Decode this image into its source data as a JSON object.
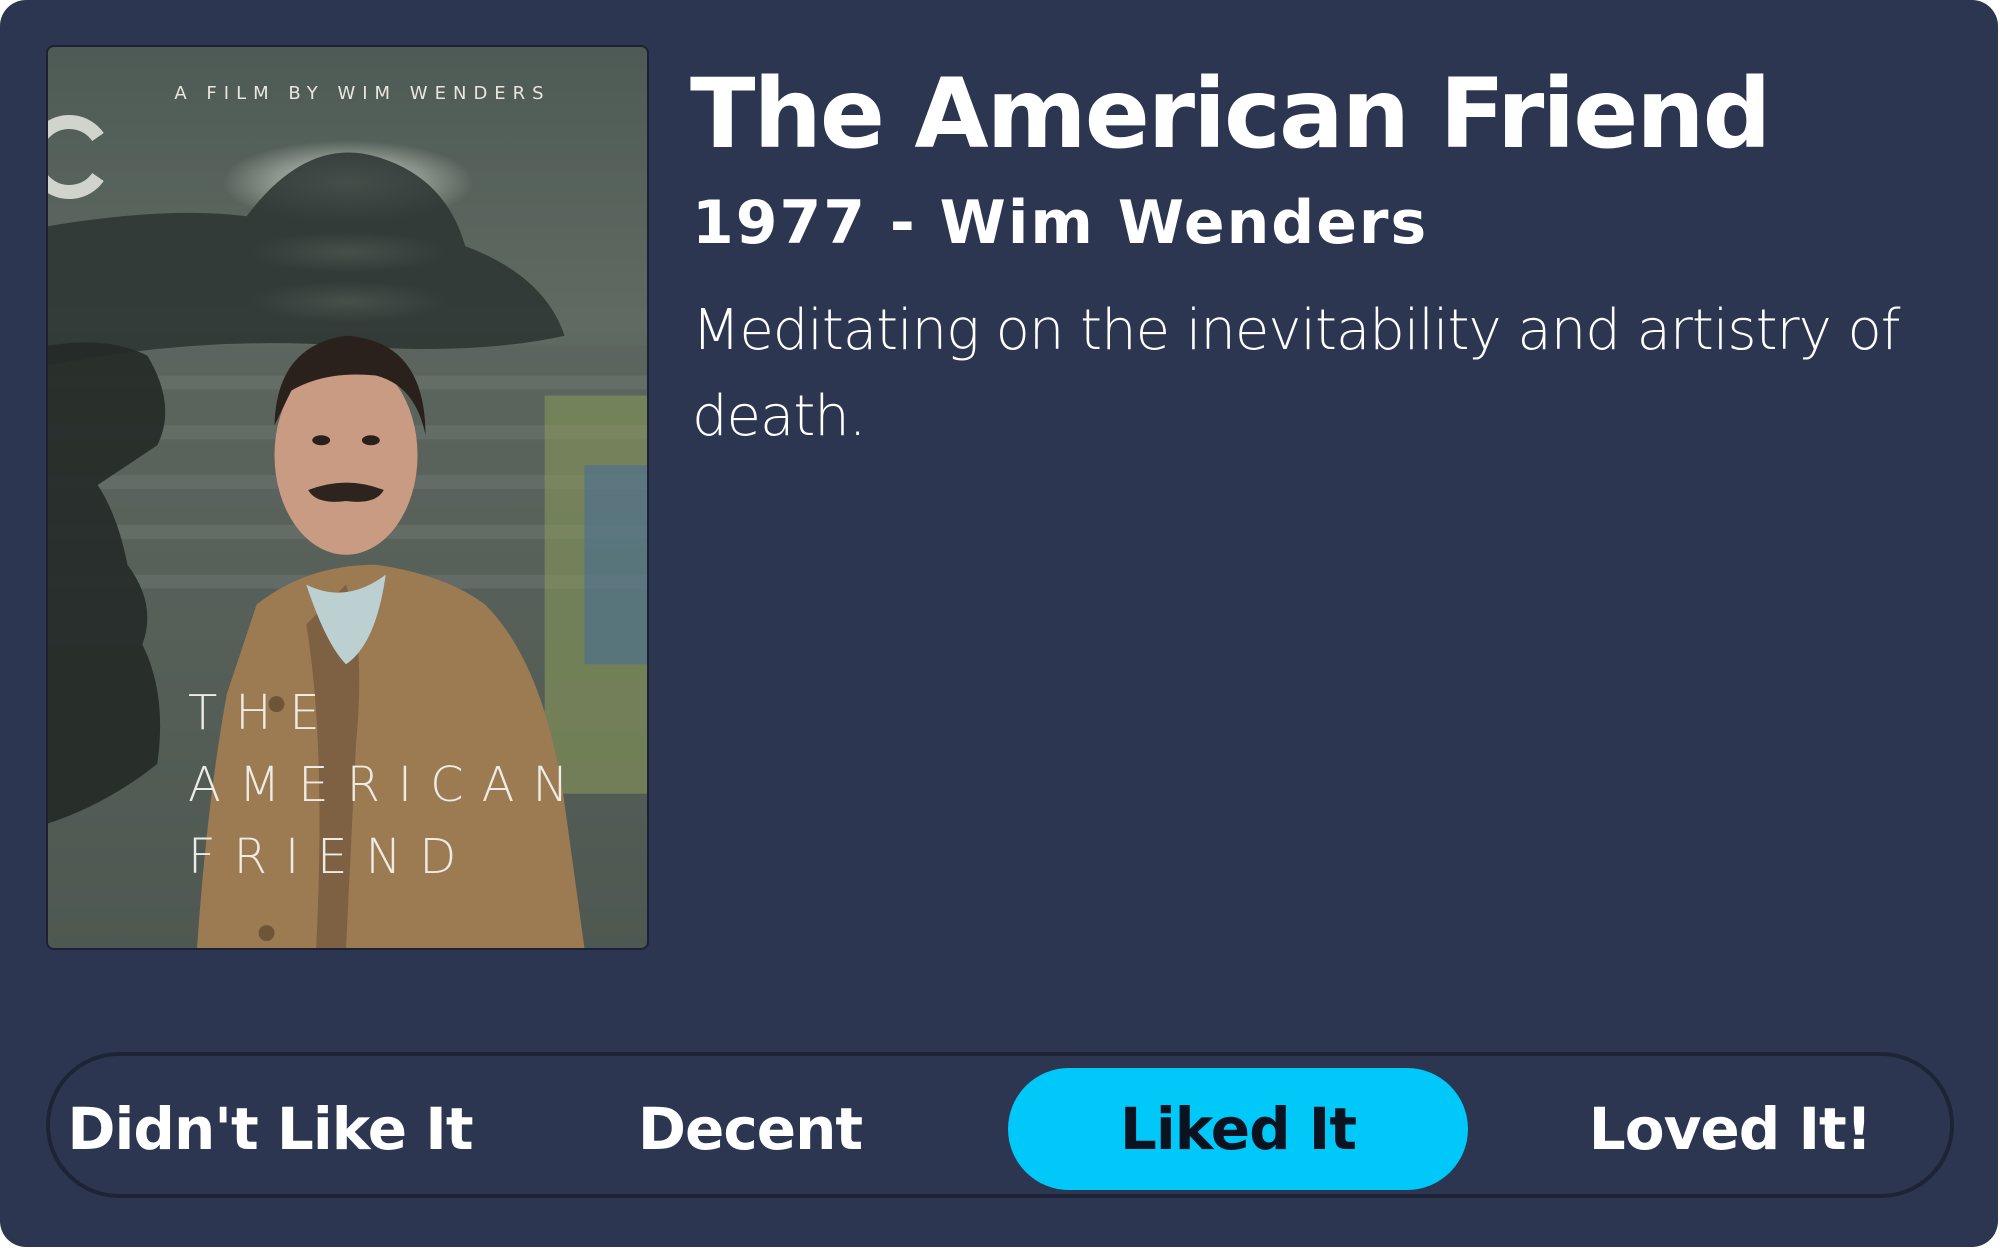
{
  "movie": {
    "title": "The American Friend",
    "subtitle": "1977 - Wim Wenders",
    "description": "Meditating on the inevitability and artistry of death."
  },
  "poster": {
    "credit": "A FILM BY WIM WENDERS",
    "title_lines": "THE\nAMERICAN\nFRIEND"
  },
  "rating": {
    "options": [
      {
        "label": "Didn't Like It",
        "selected": false
      },
      {
        "label": "Decent",
        "selected": false
      },
      {
        "label": "Liked It",
        "selected": true
      },
      {
        "label": "Loved It!",
        "selected": false
      }
    ],
    "selected_color": "#00c8f8"
  },
  "colors": {
    "card_background": "#2c3650",
    "text": "#ffffff"
  }
}
